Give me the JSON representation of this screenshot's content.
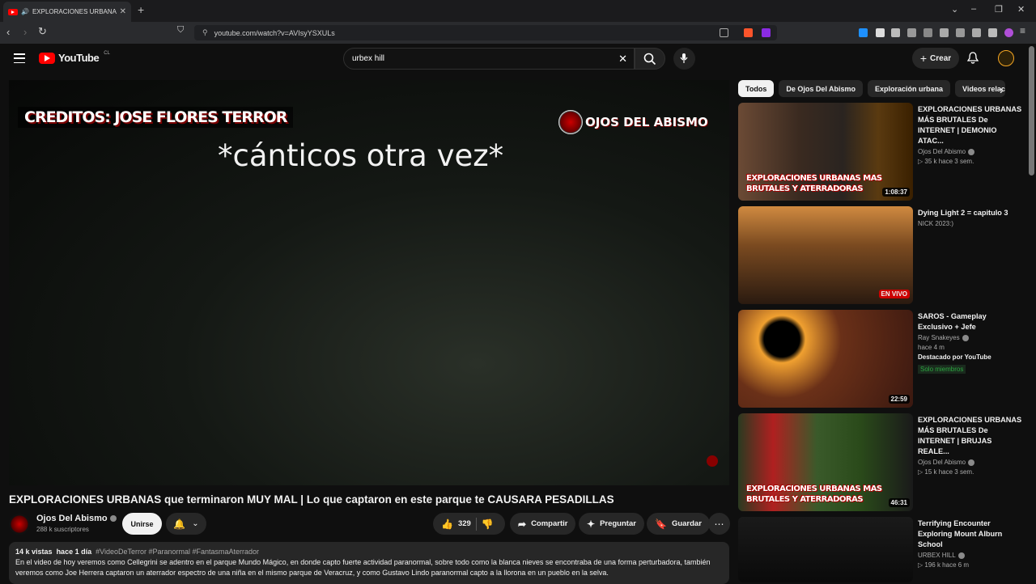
{
  "browser": {
    "tab_title": "EXPLORACIONES URBANAS q",
    "url": "youtube.com/watch?v=AVIsyYSXULs"
  },
  "header": {
    "logo_text": "YouTube",
    "country": "CL",
    "search_value": "urbex hill",
    "create_label": "Crear"
  },
  "video": {
    "overlay_credits": "CREDITOS: JOSE FLORES TERROR",
    "overlay_brand": "OJOS DEL ABISMO",
    "overlay_caption": "*cánticos otra vez*",
    "title": "EXPLORACIONES URBANAS que terminaron MUY MAL | Lo que captaron en este parque te CAUSARA PESADILLAS"
  },
  "channel": {
    "name": "Ojos Del Abismo",
    "subscribers": "288 k suscriptores",
    "join_label": "Unirse"
  },
  "actions": {
    "likes": "329",
    "share": "Compartir",
    "ask": "Preguntar",
    "save": "Guardar"
  },
  "description": {
    "views": "14 k vistas",
    "date": "hace 1 día",
    "tags": "#VideoDeTerror #Paranormal #FantasmaAterrador",
    "text": "En el video de hoy veremos como Cellegrini se adentro en el parque Mundo Mágico, en donde capto fuerte actividad paranormal, sobre todo como la blanca nieves se encontraba de una forma perturbadora, también veremos como Joe Herrera captaron un aterrador espectro de una niña en el mismo parque de Veracruz, y como Gustavo Lindo paranormal capto a la llorona en un pueblo en la selva."
  },
  "chips": [
    "Todos",
    "De Ojos Del Abismo",
    "Exploración urbana",
    "Videos relac"
  ],
  "recommendations": [
    {
      "title": "EXPLORACIONES URBANAS MÁS BRUTALES De INTERNET | DEMONIO ATAC...",
      "channel": "Ojos Del Abismo",
      "meta": "▷ 35 k  hace 3 sem.",
      "duration": "1:08:37",
      "overlay": "EXPLORACIONES URBANAS MAS BRUTALES Y ATERRADORAS"
    },
    {
      "title": "Dying Light 2 = capitulo 3",
      "channel": "NICK 2023:)",
      "meta": "",
      "live": "EN VIVO"
    },
    {
      "title": "SAROS - Gameplay Exclusivo + Jefe",
      "channel": "Ray Snakeyes",
      "meta": "hace 4 m",
      "badge": "Destacado por YouTube",
      "members": "Solo miembros",
      "duration": "22:59"
    },
    {
      "title": "EXPLORACIONES URBANAS MÁS BRUTALES De INTERNET | BRUJAS REALE...",
      "channel": "Ojos Del Abismo",
      "meta": "▷ 15 k  hace 3 sem.",
      "duration": "46:31",
      "overlay": "EXPLORACIONES URBANAS MAS BRUTALES Y ATERRADORAS"
    },
    {
      "title": "Terrifying Encounter Exploring Mount Alburn School",
      "channel": "URBEX HILL",
      "meta": "▷ 196 k  hace 6 m"
    }
  ],
  "colors": {
    "accent": "#ff0000",
    "bg": "#0f0f0f",
    "surface": "#272727"
  }
}
